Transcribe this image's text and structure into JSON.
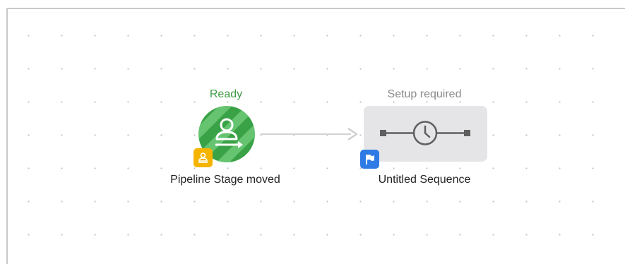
{
  "trigger": {
    "status": "Ready",
    "title": "Pipeline Stage moved",
    "icon": "person-arrow-icon",
    "badge_icon": "person-badge-icon",
    "colors": {
      "circle": "#3aa246",
      "stripe": "#5cbf68",
      "badge": "#f5b400",
      "status": "#3e9a45"
    }
  },
  "action": {
    "status": "Setup required",
    "title": "Untitled Sequence",
    "icon": "clock-timeline-icon",
    "badge_icon": "flag-icon",
    "colors": {
      "box": "#e5e5e8",
      "badge": "#2f7be5",
      "status": "#8a8a8a"
    }
  }
}
